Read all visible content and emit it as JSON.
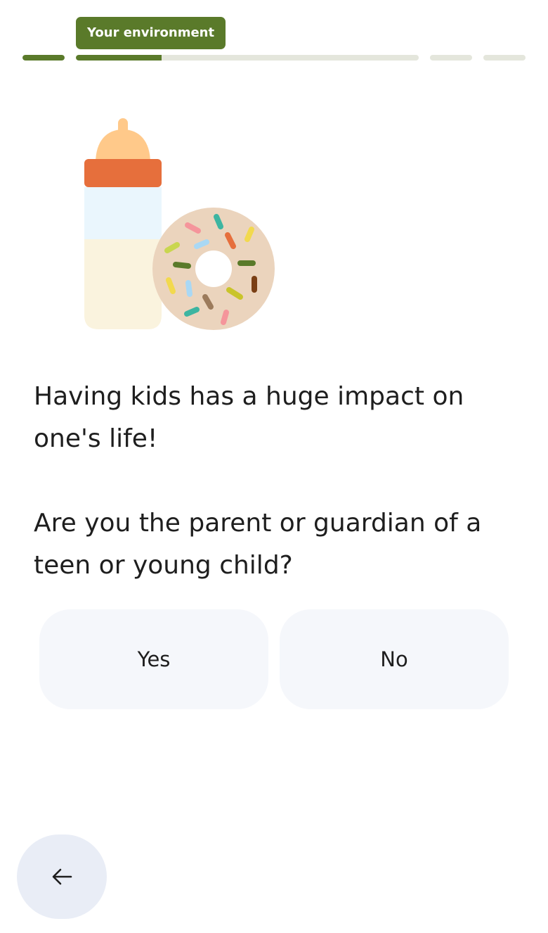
{
  "progress": {
    "stage_label": "Your environment",
    "segments": [
      {
        "name": "step-1",
        "fraction": 1.0
      },
      {
        "name": "step-2",
        "fraction": 0.25
      },
      {
        "name": "step-3",
        "fraction": 0.0
      },
      {
        "name": "step-4",
        "fraction": 0.0
      }
    ]
  },
  "illustration": {
    "icons": [
      "baby-bottle-icon",
      "donut-icon"
    ]
  },
  "content": {
    "message": "Having kids has a huge impact on one's life!",
    "question": "Are you the parent or guardian of a teen or young child?"
  },
  "answers": {
    "yes_label": "Yes",
    "no_label": "No"
  },
  "navigation": {
    "back_icon": "arrow-left-icon"
  },
  "colors": {
    "accent": "#5a7a2a",
    "track": "#e4e6dc",
    "button_bg": "#f5f7fb",
    "back_bg": "#e9edf6"
  }
}
